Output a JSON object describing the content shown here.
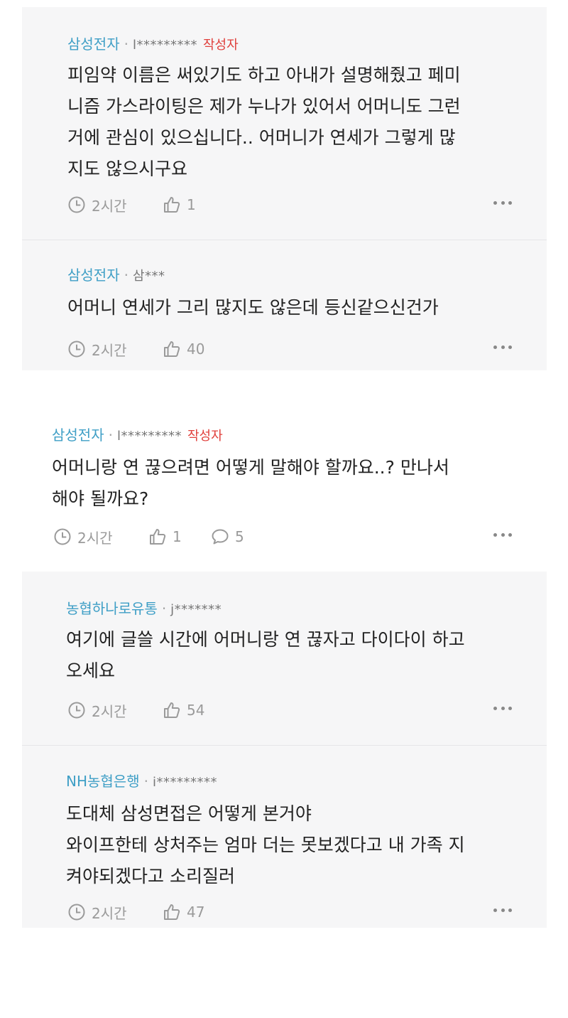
{
  "comments": [
    {
      "author": "삼성전자",
      "separator": "·",
      "user_id": "l*********",
      "badge": "작성자",
      "lines": [
        "피임약 이름은 써있기도 하고 아내가 설명해줬고 페미",
        "니즘 가스라이팅은 제가 누나가 있어서 어머니도 그런",
        "거에 관심이 있으십니다.. 어머니가 연세가 그렇게 많",
        "지도 않으시구요"
      ],
      "time": "2시간",
      "likes": "1"
    },
    {
      "author": "삼성전자",
      "separator": "·",
      "user_id": "삼***",
      "lines": [
        "어머니 연세가 그리 많지도 않은데 등신같으신건가"
      ],
      "time": "2시간",
      "likes": "40"
    },
    {
      "author": "삼성전자",
      "separator": "·",
      "user_id": "l*********",
      "badge": "작성자",
      "lines": [
        "어머니랑 연 끊으려면 어떻게 말해야 할까요..? 만나서",
        "해야 될까요?"
      ],
      "time": "2시간",
      "likes": "1",
      "replies": "5"
    },
    {
      "author": "농협하나로유통",
      "separator": "·",
      "user_id": "j*******",
      "lines": [
        "여기에 글쓸 시간에 어머니랑 연 끊자고 다이다이 하고",
        "오세요"
      ],
      "time": "2시간",
      "likes": "54"
    },
    {
      "author": "NH농협은행",
      "separator": "·",
      "user_id": "i*********",
      "lines": [
        "도대체 삼성면접은 어떻게 본거야",
        "와이프한테 상처주는 엄마 더는 못보겠다고 내 가족 지",
        "켜야되겠다고 소리질러"
      ],
      "time": "2시간",
      "likes": "47"
    }
  ],
  "colors": {
    "author": "#3f9fc6",
    "badge": "#e0403c",
    "reply_bg": "#f6f6f7"
  },
  "icons": {
    "time": "clock-icon",
    "like": "thumbs-up-icon",
    "reply": "speech-bubble-icon",
    "more": "more-dots-icon"
  }
}
